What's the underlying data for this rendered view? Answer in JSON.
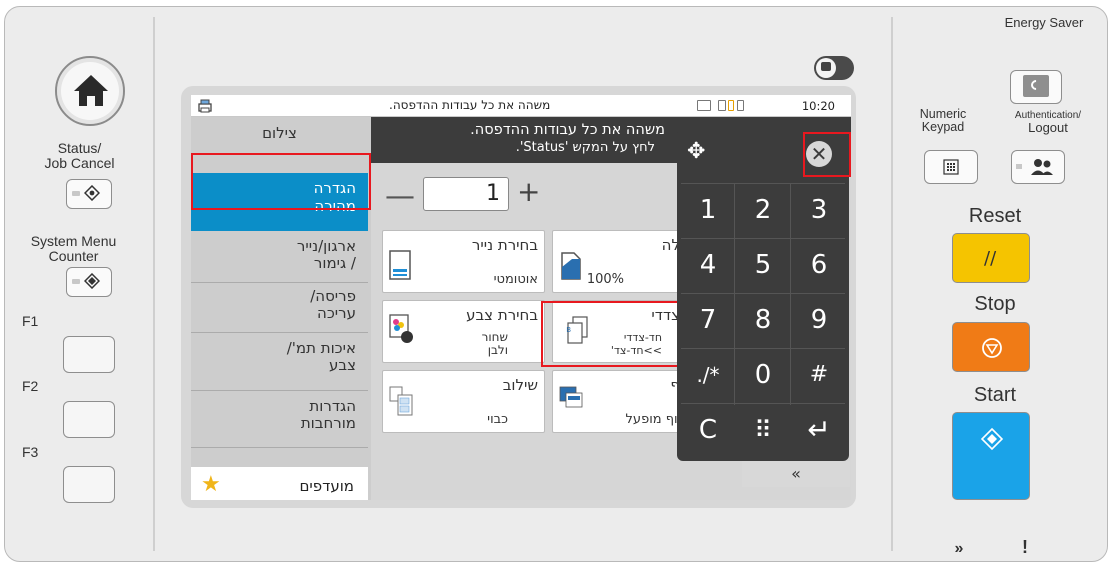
{
  "left_panel": {
    "status_label_1": "Status/",
    "status_label_2": "Job Cancel",
    "system_label_1": "System Menu",
    "system_label_2": "Counter",
    "f1": "F1",
    "f2": "F2",
    "f3": "F3"
  },
  "screen": {
    "status_bar": {
      "message": "משהה את כל עבודות ההדפסה.",
      "time": "10:20"
    },
    "menu": {
      "copy_tab": "צילום",
      "quick_setup_1": "הגדרה",
      "quick_setup_2": "מהירה",
      "org_paper_1": "ארגון/נייר",
      "org_paper_2": "/ גימור",
      "layout_1": "פריסה/",
      "layout_2": "עריכה",
      "quality_1": "איכות תמ'/",
      "quality_2": "צבע",
      "advanced_1": "הגדרות",
      "advanced_2": "מורחבות",
      "favorites": "מועדפים"
    },
    "banner": {
      "line1": "משהה את כל עבודות ההדפסה.",
      "line2": "לחץ על המקש 'Status'."
    },
    "copies": {
      "value": "1",
      "minus": "—",
      "plus": "+"
    },
    "tiles": {
      "paper_title": "בחירת נייר",
      "paper_value": "אוטומטי",
      "zoom_title": "לה",
      "zoom_value": "100%",
      "color_title": "בחירת צבע",
      "color_value_1": "שחור",
      "color_value_2": "ולבן",
      "duplex_title": "צדדי",
      "duplex_value_1": "חד-צדדי",
      "duplex_value_2": ">>חד-צד'",
      "combine_title": "שילוב",
      "combine_value": "כבוי",
      "collate_title": "ף",
      "collate_value": "סוף מופעל"
    },
    "keypad": {
      "keys": [
        "1",
        "2",
        "3",
        "4",
        "5",
        "6",
        "7",
        "8",
        "9",
        "./*",
        "0",
        "#",
        "C",
        "⠿",
        "↵"
      ],
      "close": "✕",
      "move": "✥",
      "collapse": "«"
    }
  },
  "right_panel": {
    "energy_saver": "Energy Saver",
    "numeric_keypad_1": "Numeric",
    "numeric_keypad_2": "Keypad",
    "auth_1": "Authentication/",
    "auth_2": "Logout",
    "reset": "Reset",
    "stop": "Stop",
    "start": "Start",
    "bottom_1": "»",
    "bottom_2": "!"
  },
  "colors": {
    "accent_blue": "#0b8ec8",
    "highlight_red": "#e8181f",
    "reset_yellow": "#f5c400",
    "stop_orange": "#f07b16",
    "start_blue": "#1aa3e8"
  }
}
